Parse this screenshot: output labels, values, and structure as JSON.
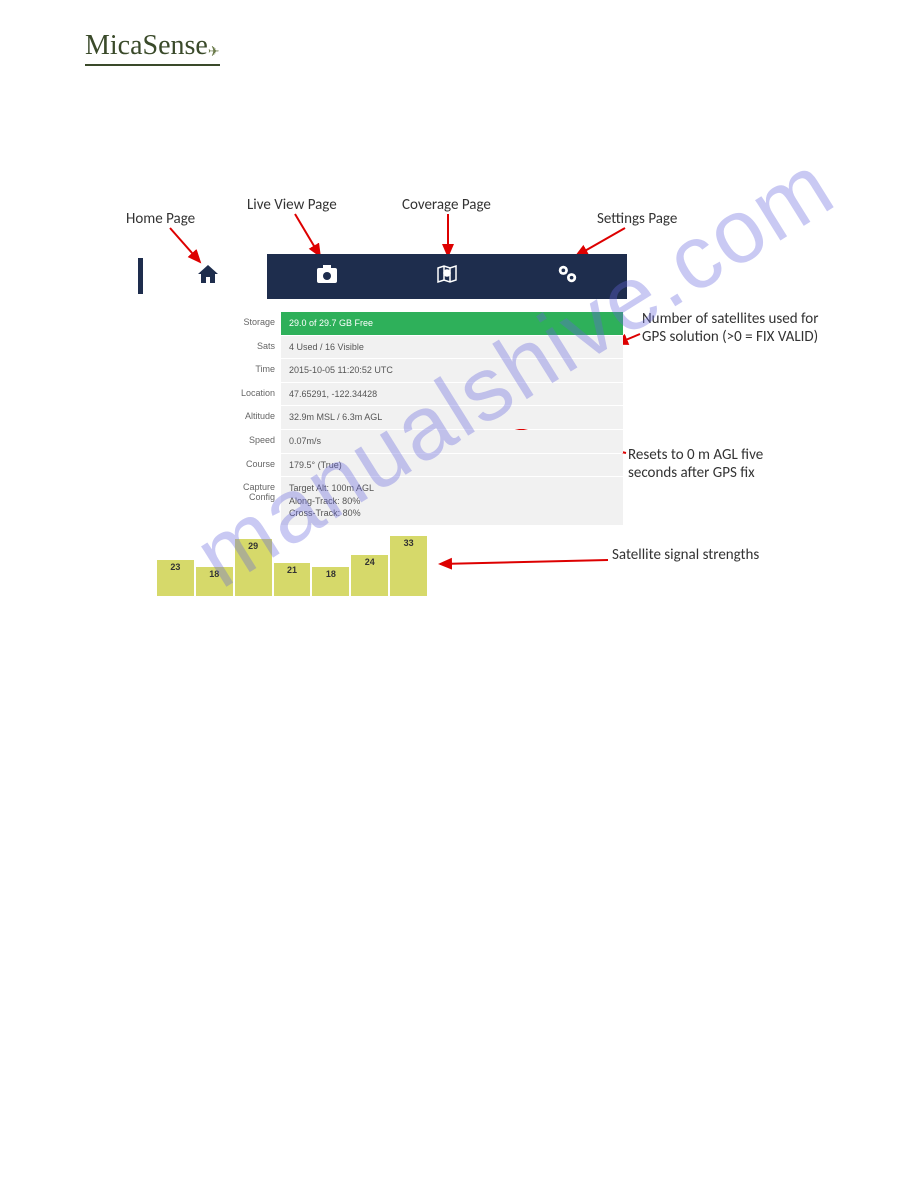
{
  "brand": "MicaSense",
  "labels": {
    "home": "Home Page",
    "liveview": "Live View Page",
    "coverage": "Coverage Page",
    "settings": "Settings Page"
  },
  "status": {
    "storage_label": "Storage",
    "storage_value": "29.0 of 29.7 GB Free",
    "sats_label": "Sats",
    "sats_value": "4 Used / 16 Visible",
    "time_label": "Time",
    "time_value": "2015-10-05 11:20:52 UTC",
    "location_label": "Location",
    "location_value": "47.65291, -122.34428",
    "altitude_label": "Altitude",
    "altitude_value": "32.9m MSL / 6.3m AGL",
    "speed_label": "Speed",
    "speed_value": "0.07m/s",
    "course_label": "Course",
    "course_value": "179.5° (True)",
    "capture_label": "Capture Config",
    "capture_value": "Target Alt: 100m AGL\nAlong-Track: 80%\nCross-Track: 80%"
  },
  "annotations": {
    "sats": "Number of satellites used for GPS solution (>0 = FIX VALID)",
    "altitude": "Resets to 0 m AGL five seconds after GPS fix",
    "signal": "Satellite signal strengths"
  },
  "chart_data": {
    "type": "bar",
    "values": [
      23,
      18,
      29,
      21,
      18,
      24,
      33
    ],
    "title": "",
    "xlabel": "",
    "ylabel": "",
    "ylim": [
      0,
      40
    ]
  },
  "watermark": "manualshive.com"
}
